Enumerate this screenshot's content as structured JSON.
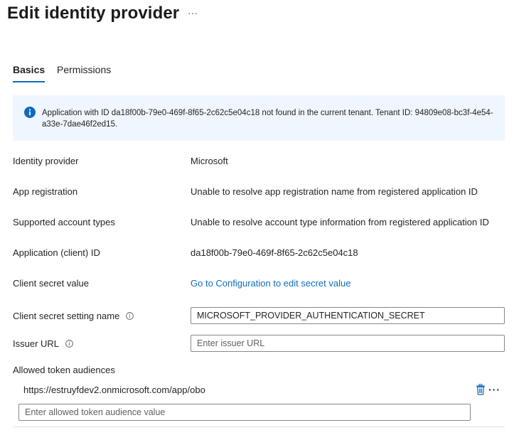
{
  "page": {
    "title": "Edit identity provider",
    "more_label": "···"
  },
  "tabs": [
    {
      "label": "Basics",
      "active": true
    },
    {
      "label": "Permissions",
      "active": false
    }
  ],
  "banner": {
    "text": "Application with ID da18f00b-79e0-469f-8f65-2c62c5e04c18 not found in the current tenant. Tenant ID: 94809e08-bc3f-4e54-a33e-7dae46f2ed15.",
    "icon": "info-icon"
  },
  "fields": {
    "identity_provider": {
      "label": "Identity provider",
      "value": "Microsoft"
    },
    "app_registration": {
      "label": "App registration",
      "value": "Unable to resolve app registration name from registered application ID"
    },
    "account_types": {
      "label": "Supported account types",
      "value": "Unable to resolve account type information from registered application ID"
    },
    "client_id": {
      "label": "Application (client) ID",
      "value": "da18f00b-79e0-469f-8f65-2c62c5e04c18"
    },
    "client_secret": {
      "label": "Client secret value",
      "link": "Go to Configuration to edit secret value"
    },
    "secret_setting_name": {
      "label": "Client secret setting name",
      "value": "MICROSOFT_PROVIDER_AUTHENTICATION_SECRET"
    },
    "issuer_url": {
      "label": "Issuer URL",
      "value": "",
      "placeholder": "Enter issuer URL"
    },
    "audiences": {
      "label": "Allowed token audiences",
      "items": [
        {
          "value": "https://estruyfdev2.onmicrosoft.com/app/obo"
        }
      ],
      "new_placeholder": "Enter allowed token audience value",
      "row_more_label": "···"
    }
  },
  "colors": {
    "accent": "#0f6cbd",
    "banner_bg": "#f0f6ff",
    "text": "#242424"
  }
}
